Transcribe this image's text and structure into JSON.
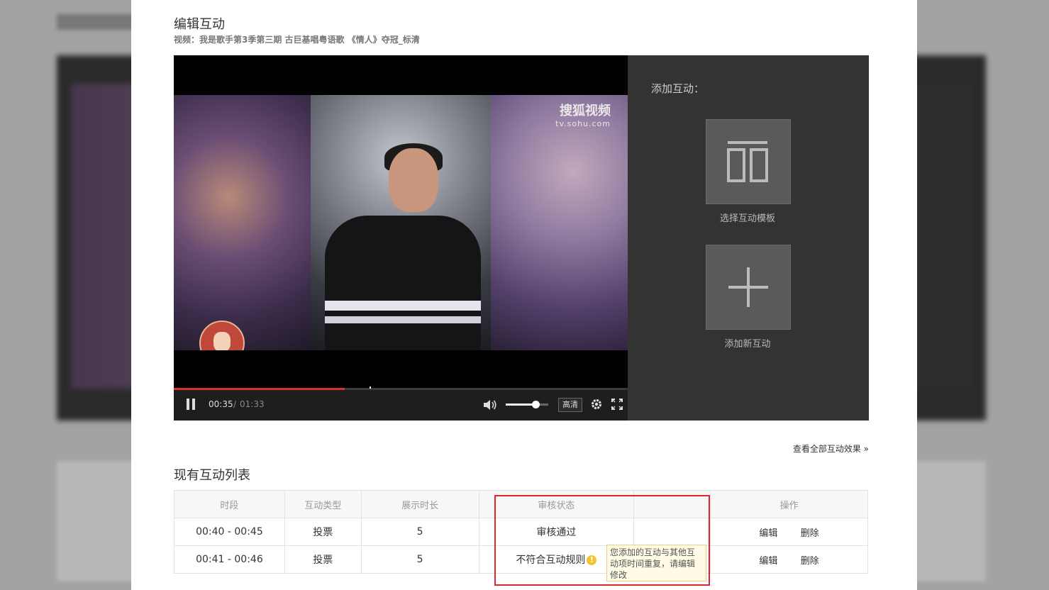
{
  "modal": {
    "title": "编辑互动",
    "video_caption": "视频：我是歌手第3季第三期 古巨基唱粤语歌 《情人》夺冠_标清"
  },
  "player": {
    "watermark_top": "搜狐视频",
    "watermark_bottom": "tv.sohu.com",
    "current_time": "00:35",
    "separator": "/",
    "total_time": "01:33",
    "quality_label": "高清",
    "progress_fraction": 0.376,
    "buffer_fraction": 0.431,
    "volume_fraction": 0.7,
    "progress_color": "#d9342b"
  },
  "side_panel": {
    "title": "添加互动：",
    "template_label": "选择互动模板",
    "new_label": "添加新互动"
  },
  "view_all_label": "查看全部互动效果",
  "list": {
    "title": "现有互动列表",
    "headers": [
      "时段",
      "互动类型",
      "展示时长",
      "审核状态",
      "",
      "操作"
    ],
    "rows": [
      {
        "period": "00:40 - 00:45",
        "type": "投票",
        "duration": "5",
        "status": "审核通过",
        "edit": "编辑",
        "delete": "删除"
      },
      {
        "period": "00:41 - 00:46",
        "type": "投票",
        "duration": "5",
        "status": "不符合互动规则",
        "edit": "编辑",
        "delete": "删除"
      }
    ],
    "tooltip": "您添加的互动与其他互动项时间重复，请编辑修改"
  },
  "colors": {
    "highlight": "#e0262c",
    "side_panel_bg": "#333333",
    "warn": "#f4c430"
  }
}
